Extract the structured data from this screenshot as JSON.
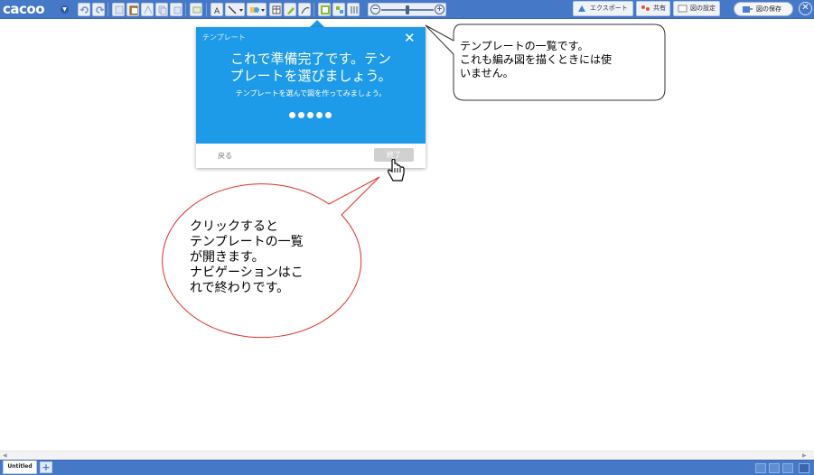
{
  "toolbar": {
    "logo": "cacoo",
    "export_label": "エクスポート",
    "share_label": "共有",
    "settings_label": "図の設定",
    "save_label": "図の保存"
  },
  "tour": {
    "label": "テンプレート",
    "close": "✕",
    "title_line1": "これで準備完了です。テン",
    "title_line2": "プレートを選びましょう。",
    "subtitle": "テンプレートを選んで図を作ってみましょう。",
    "dots": 5,
    "back_label": "戻る",
    "done_label": "終了"
  },
  "callouts": {
    "top_right": [
      "テンプレートの一覧です。",
      "これも編み図を描くときには使",
      "いません。"
    ],
    "bottom_left": [
      "クリックすると",
      "テンプレートの一覧",
      "が開きます。",
      "ナビゲーションはこ",
      "れで終わりです。"
    ]
  },
  "bottom": {
    "page_tab": "Untitled",
    "add_page": "+"
  },
  "colors": {
    "toolbar": "#4579c8",
    "tour_blue": "#1e9be8",
    "callout_red": "#e0302a"
  }
}
